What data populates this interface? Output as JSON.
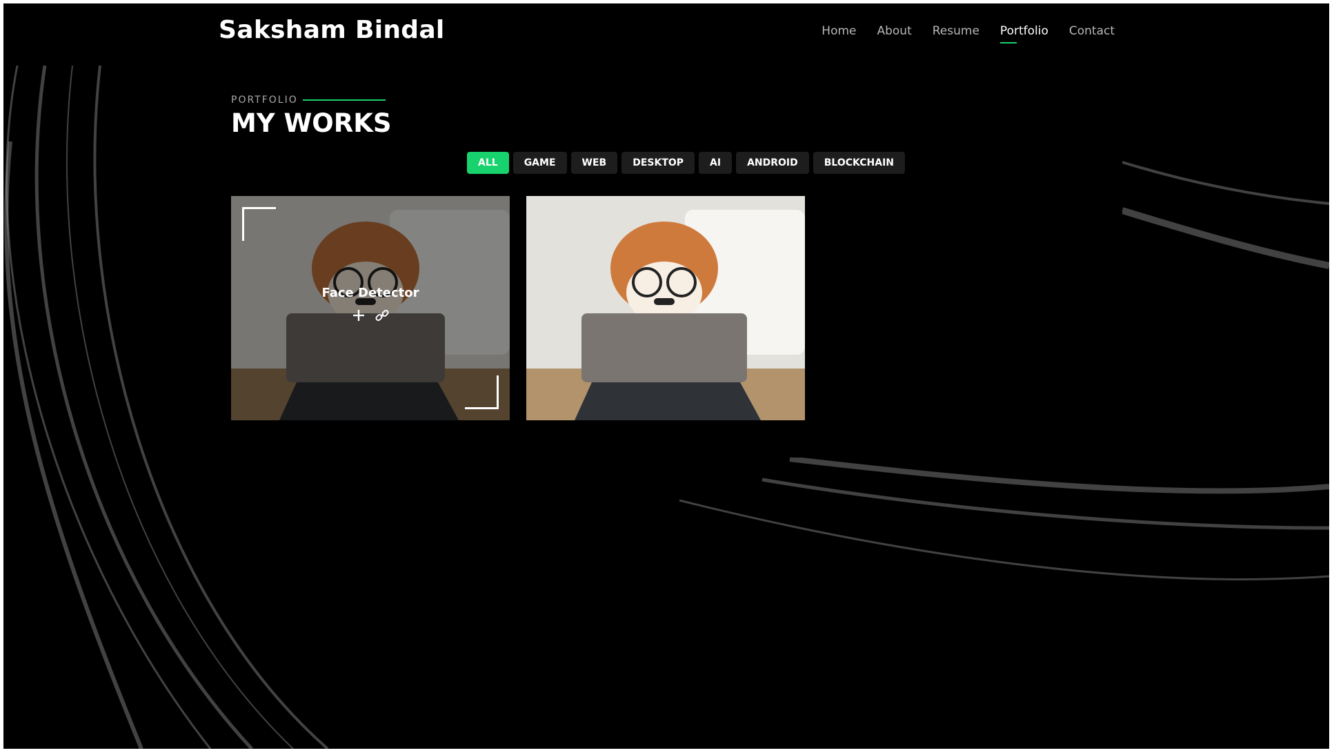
{
  "header": {
    "brand": "Saksham Bindal",
    "nav": [
      "Home",
      "About",
      "Resume",
      "Portfolio",
      "Contact"
    ],
    "active_nav": "Portfolio"
  },
  "section": {
    "eyebrow": "PORTFOLIO",
    "title": "MY WORKS"
  },
  "filters": [
    "ALL",
    "GAME",
    "WEB",
    "DESKTOP",
    "AI",
    "ANDROID",
    "BLOCKCHAIN"
  ],
  "active_filter": "ALL",
  "portfolio": {
    "items": [
      {
        "title": "Face Detector",
        "image": "dog-with-glasses-at-tablet",
        "hovered": true
      },
      {
        "title": "",
        "image": "dog-with-glasses-at-tablet",
        "hovered": false
      }
    ]
  },
  "colors": {
    "accent": "#18d26e",
    "background": "#000000"
  },
  "icons": {
    "details": "plus-icon",
    "link": "link-icon"
  }
}
